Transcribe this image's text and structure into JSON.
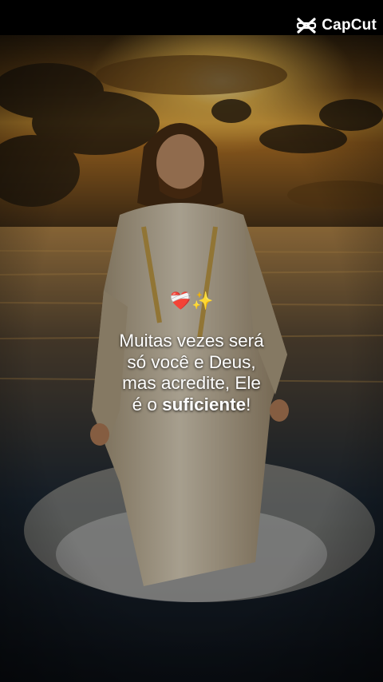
{
  "brand": {
    "logo_text": "CapCut",
    "logo_icon": "capcut-logo-icon"
  },
  "caption": {
    "emoji": "❤️‍🩹✨",
    "line1": "Muitas vezes será",
    "line2": "só você e Deus,",
    "line3": "mas acredite, Ele",
    "line4_prefix": "é o ",
    "line4_bold": "suficiente",
    "line4_suffix": "!"
  },
  "scene": {
    "description_icon": "jesus-walking-on-water-image",
    "sky_color": "#e8a63a",
    "sea_color": "#1e2a36",
    "robe_color": "#e7dcc5"
  }
}
